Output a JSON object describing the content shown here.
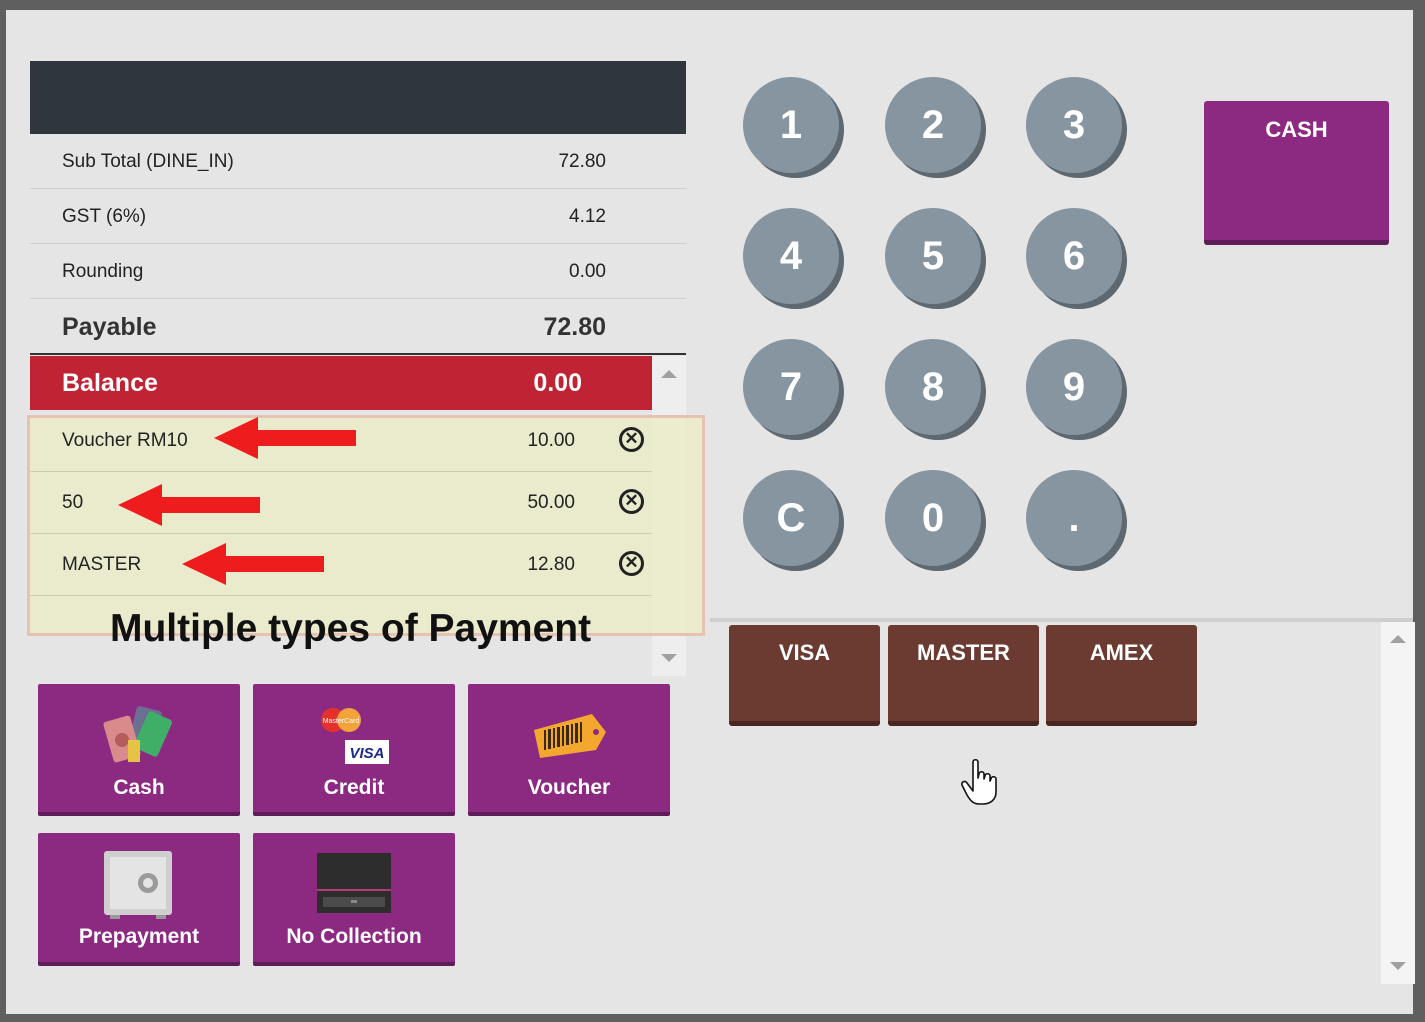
{
  "summary": {
    "subtotal": {
      "label": "Sub Total (DINE_IN)",
      "value": "72.80"
    },
    "gst": {
      "label": "GST (6%)",
      "value": "4.12"
    },
    "rounding": {
      "label": "Rounding",
      "value": "0.00"
    },
    "payable": {
      "label": "Payable",
      "value": "72.80"
    },
    "balance": {
      "label": "Balance",
      "value": "0.00"
    }
  },
  "payments": [
    {
      "label": "Voucher RM10",
      "value": "10.00"
    },
    {
      "label": "50",
      "value": "50.00"
    },
    {
      "label": "MASTER",
      "value": "12.80"
    }
  ],
  "remove_glyph": "✕",
  "annotation": "Multiple types of Payment",
  "payment_types": {
    "cash": "Cash",
    "credit": "Credit",
    "voucher": "Voucher",
    "prepayment": "Prepayment",
    "no_collection": "No Collection"
  },
  "card_logos": {
    "mastercard": "MasterCard",
    "visa": "VISA"
  },
  "keypad": [
    "1",
    "2",
    "3",
    "4",
    "5",
    "6",
    "7",
    "8",
    "9",
    "C",
    "0",
    "."
  ],
  "quick_cash": {
    "label": "CASH"
  },
  "card_types": [
    "VISA",
    "MASTER",
    "AMEX"
  ],
  "colors": {
    "accent_purple": "#8c2a82",
    "balance_red": "#c02334",
    "card_brown": "#6b3a31",
    "key_grey": "#8795a0",
    "header_dark": "#2f363d"
  }
}
